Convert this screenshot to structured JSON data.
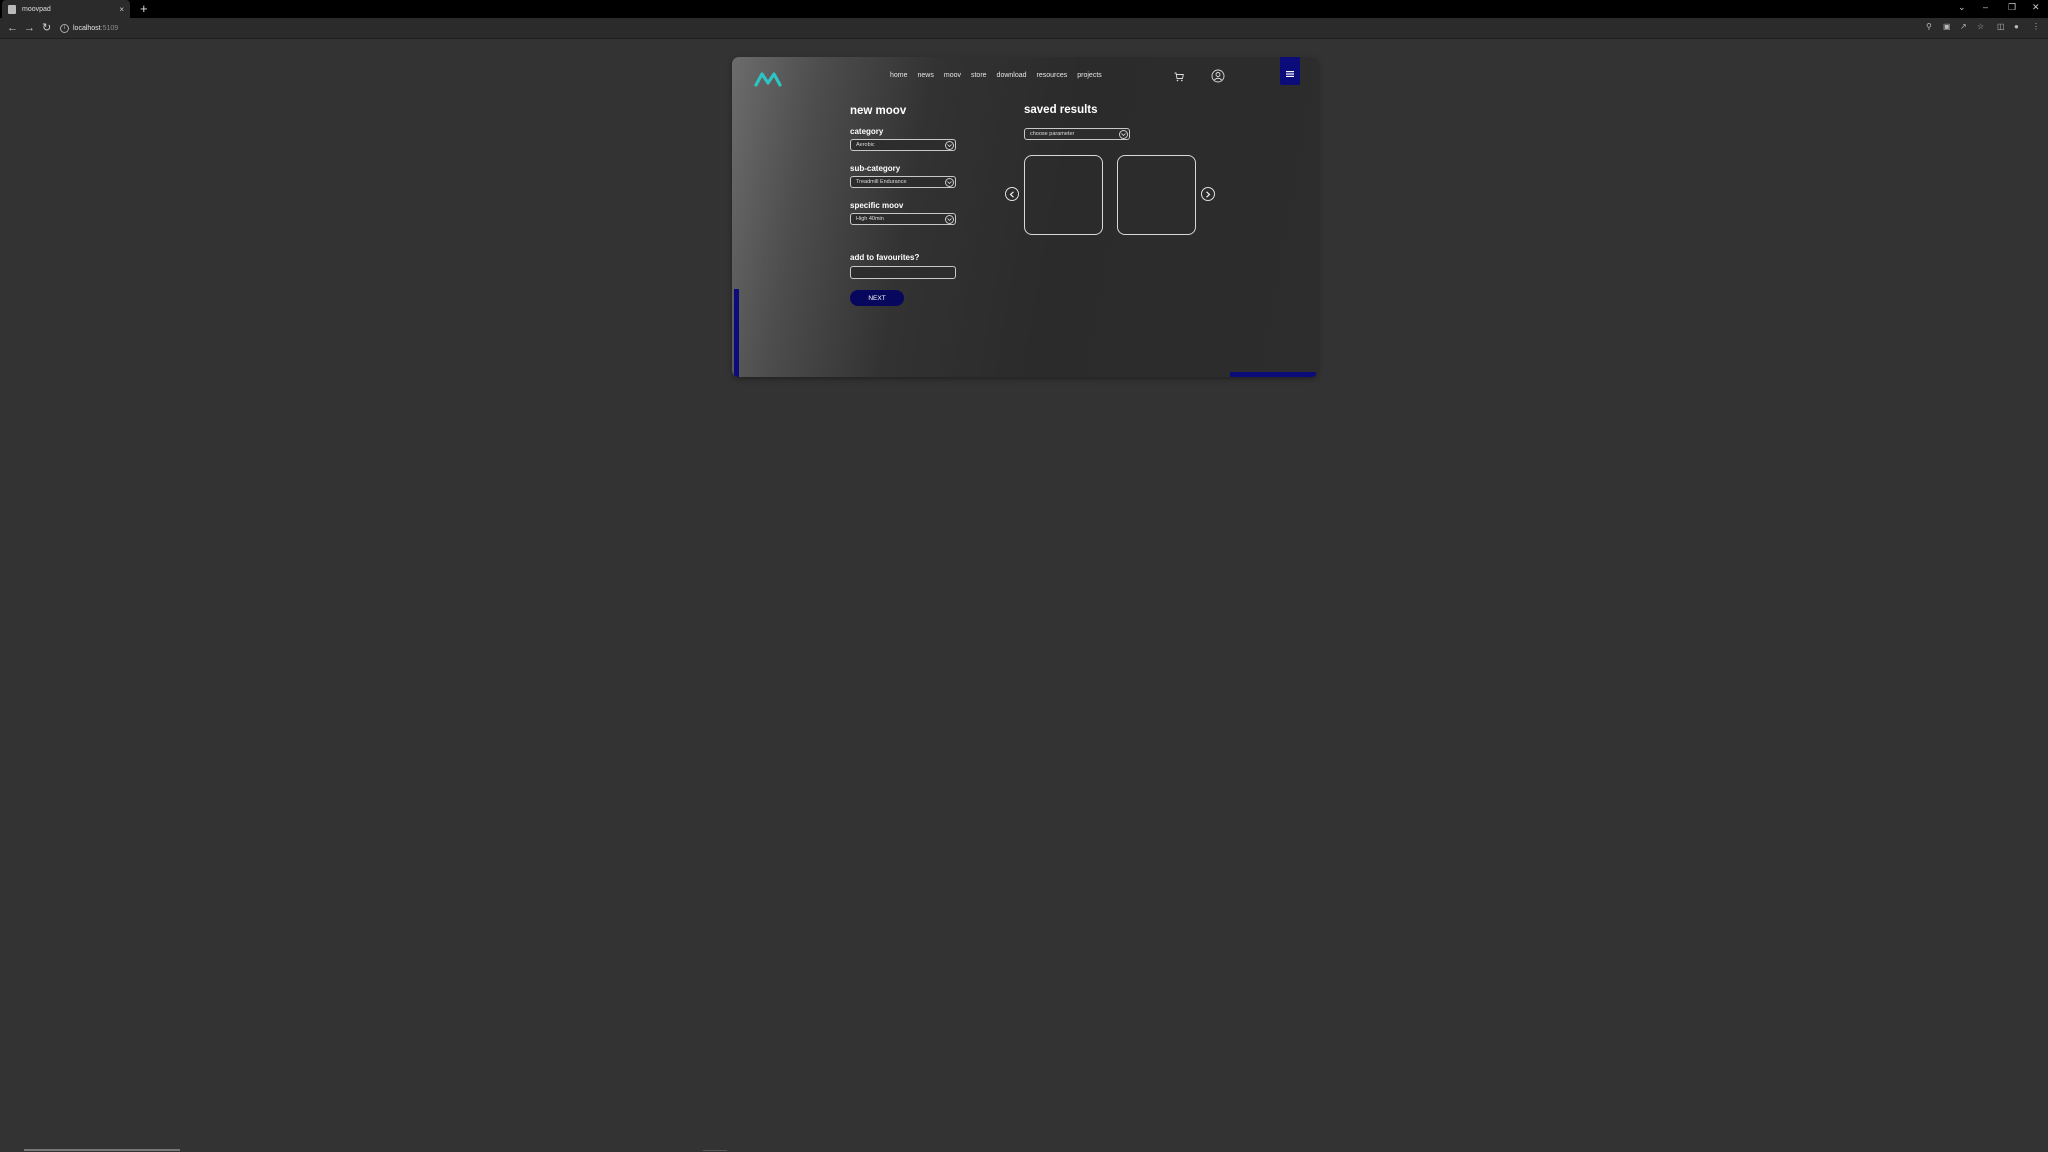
{
  "browser": {
    "tab_title": "moovpad",
    "tab_close": "×",
    "new_tab": "+",
    "url_host": "localhost",
    "url_port": ":5109",
    "win_min": "–",
    "win_max": "❐",
    "win_close": "✕",
    "win_down": "⌄"
  },
  "nav": {
    "items": [
      "home",
      "news",
      "moov",
      "store",
      "download",
      "resources",
      "projects"
    ]
  },
  "form": {
    "title": "new moov",
    "category_label": "category",
    "category_value": "Aerobic",
    "subcategory_label": "sub-category",
    "subcategory_value": "Treadmill Endurance",
    "specific_label": "specific moov",
    "specific_value": "High 40min",
    "favourites_label": "add to favourites?",
    "favourites_value": "",
    "next_label": "NEXT"
  },
  "results": {
    "title": "saved results",
    "parameter_value": "choose parameter"
  },
  "colors": {
    "accent_blue": "#0b0b7a",
    "button_blue": "#07075e",
    "logo_teal": "#2ec4c4",
    "background": "#333333"
  },
  "icons": {
    "logo": "moovpad-logo-icon",
    "cart": "cart-icon",
    "user": "user-circle-icon",
    "menu": "hamburger-menu-icon",
    "prev": "chevron-left-circle-icon",
    "next": "chevron-right-circle-icon"
  }
}
